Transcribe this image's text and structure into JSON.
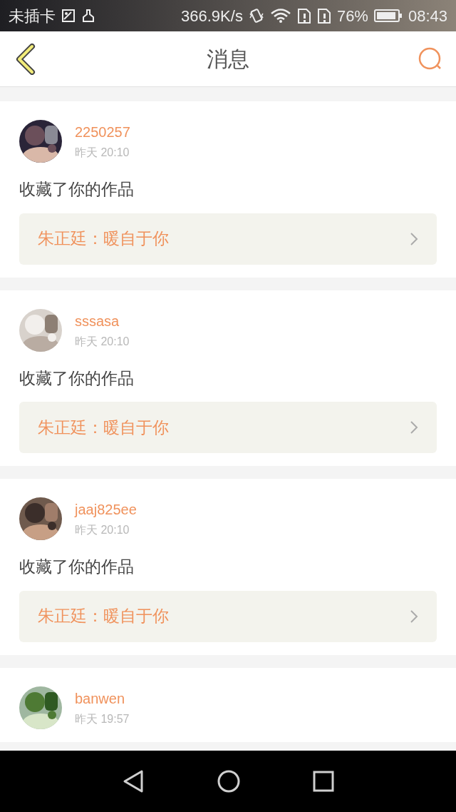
{
  "status_bar": {
    "carrier": "未插卡",
    "speed": "366.9K/s",
    "battery": "76%",
    "time": "08:43"
  },
  "header": {
    "title": "消息"
  },
  "messages": [
    {
      "user": "2250257",
      "time": "昨天 20:10",
      "action": "收藏了你的作品",
      "work": "朱正廷：暖自于你"
    },
    {
      "user": "sssasa",
      "time": "昨天 20:10",
      "action": "收藏了你的作品",
      "work": "朱正廷：暖自于你"
    },
    {
      "user": "jaaj825ee",
      "time": "昨天 20:10",
      "action": "收藏了你的作品",
      "work": "朱正廷：暖自于你"
    },
    {
      "user": "banwen",
      "time": "昨天 19:57"
    }
  ]
}
